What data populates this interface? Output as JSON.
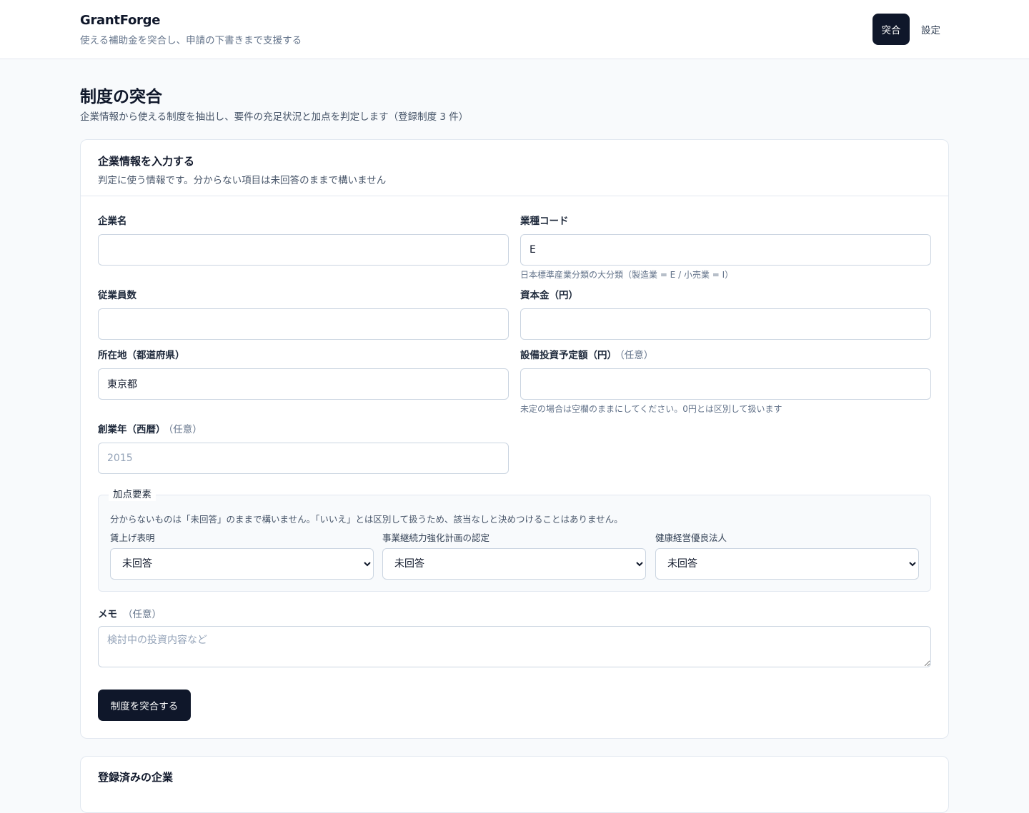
{
  "header": {
    "brand_name": "GrantForge",
    "tagline": "使える補助金を突合し、申請の下書きまで支援する",
    "nav": [
      {
        "label": "突合",
        "active": true
      },
      {
        "label": "設定",
        "active": false
      }
    ]
  },
  "page": {
    "title": "制度の突合",
    "subtitle": "企業情報から使える制度を抽出し、要件の充足状況と加点を判定します（登録制度 3 件）"
  },
  "form_card": {
    "title": "企業情報を入力する",
    "description": "判定に使う情報です。分からない項目は未回答のままで構いません",
    "fields": {
      "company_name": {
        "label": "企業名",
        "value": "",
        "placeholder": ""
      },
      "industry_code": {
        "label": "業種コード",
        "value": "E",
        "placeholder": "",
        "hint": "日本標準産業分類の大分類（製造業 = E / 小売業 = I）"
      },
      "employees": {
        "label": "従業員数",
        "value": "",
        "placeholder": ""
      },
      "capital": {
        "label": "資本金（円）",
        "value": "",
        "placeholder": ""
      },
      "prefecture": {
        "label": "所在地（都道府県）",
        "value": "東京都",
        "placeholder": ""
      },
      "capex": {
        "label": "設備投資予定額（円）",
        "optional": "（任意）",
        "value": "",
        "placeholder": "",
        "hint": "未定の場合は空欄のままにしてください。0円とは区別して扱います"
      },
      "founded_year": {
        "label": "創業年（西暦）",
        "optional": "（任意）",
        "value": "",
        "placeholder": "2015"
      }
    },
    "bonus": {
      "legend": "加点要素",
      "note": "分からないものは「未回答」のままで構いません。「いいえ」とは区別して扱うため、該当なしと決めつけることはありません。",
      "selects": [
        {
          "label": "賃上げ表明",
          "value": "未回答"
        },
        {
          "label": "事業継続力強化計画の認定",
          "value": "未回答"
        },
        {
          "label": "健康経営優良法人",
          "value": "未回答"
        }
      ]
    },
    "memo": {
      "label": "メモ",
      "optional": "（任意）",
      "placeholder": "検討中の投資内容など",
      "value": ""
    },
    "submit_label": "制度を突合する"
  },
  "registered_card": {
    "title": "登録済みの企業"
  }
}
